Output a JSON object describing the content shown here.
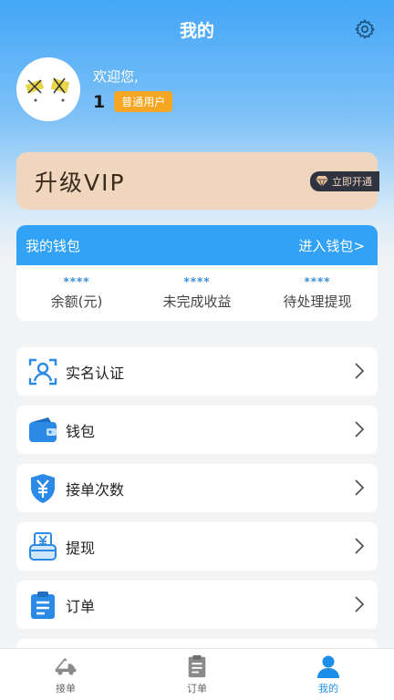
{
  "header": {
    "title": "我的",
    "settings_icon": "gear-icon"
  },
  "profile": {
    "welcome": "欢迎您,",
    "user_id": "1",
    "badge": "普通用户"
  },
  "vip": {
    "title": "升级VIP",
    "button": "立即开通",
    "bg_color": "#f0d6bf"
  },
  "wallet": {
    "title": "我的钱包",
    "enter": "进入钱包>",
    "columns": [
      {
        "value": "****",
        "label": "余额(元)"
      },
      {
        "value": "****",
        "label": "未完成收益"
      },
      {
        "value": "****",
        "label": "待处理提现"
      }
    ],
    "accent": "#31a2f5"
  },
  "menu": [
    {
      "label": "实名认证",
      "icon": "id-verify-icon"
    },
    {
      "label": "钱包",
      "icon": "wallet-icon"
    },
    {
      "label": "接单次数",
      "icon": "yuan-shield-icon"
    },
    {
      "label": "提现",
      "icon": "withdraw-icon"
    },
    {
      "label": "订单",
      "icon": "clipboard-icon"
    }
  ],
  "tabbar": [
    {
      "label": "接单",
      "icon": "tow-truck-icon",
      "active": false
    },
    {
      "label": "订单",
      "icon": "order-list-icon",
      "active": false
    },
    {
      "label": "我的",
      "icon": "person-icon",
      "active": true
    }
  ]
}
